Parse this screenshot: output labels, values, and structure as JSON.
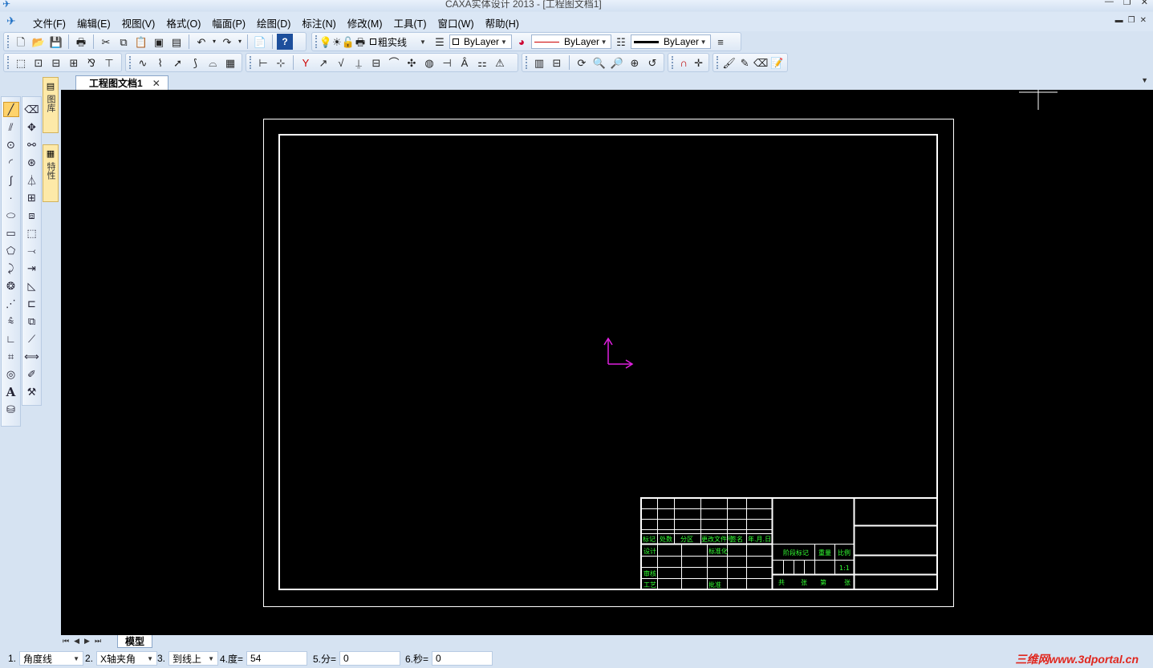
{
  "window": {
    "title": "CAXA实体设计 2013 - [工程图文档1]",
    "app_icon": "caxa-logo-icon"
  },
  "menu": {
    "items": [
      "文件(F)",
      "编辑(E)",
      "视图(V)",
      "格式(O)",
      "幅面(P)",
      "绘图(D)",
      "标注(N)",
      "修改(M)",
      "工具(T)",
      "窗口(W)",
      "帮助(H)"
    ]
  },
  "toolbar": {
    "line_style_label": "粗实线",
    "color_combo": "ByLayer",
    "linetype_combo": "ByLayer",
    "lineweight_combo": "ByLayer"
  },
  "document": {
    "tab_label": "工程图文档1",
    "model_tab": "模型"
  },
  "title_block": {
    "row_labels": [
      "标记",
      "处数",
      "分区",
      "更改文件号",
      "签名",
      "年.月.日"
    ],
    "design": "设计",
    "standardization": "标准化",
    "stage_mark": "阶段标记",
    "weight": "重量",
    "scale": "比例",
    "scale_value": "1:1",
    "review": "审核",
    "process": "工艺",
    "approve": "批准",
    "sheet_text": [
      "共",
      "张",
      "第",
      "张"
    ]
  },
  "status": {
    "field1_label": "1.",
    "field1_value": "角度线",
    "field2_label": "2.",
    "field2_value": "X轴夹角",
    "field3_label": "3.",
    "field3_value": "到线上",
    "field4_label": "4.度=",
    "field4_value": "54",
    "field5_label": "5.分=",
    "field5_value": "0",
    "field6_label": "6.秒=",
    "field6_value": "0"
  },
  "watermark": "三维网www.3dportal.cn",
  "colors": {
    "canvas_bg": "#000000",
    "frame_line": "#ffffff",
    "table_text": "#33ff33",
    "axis": "#e020e0"
  }
}
